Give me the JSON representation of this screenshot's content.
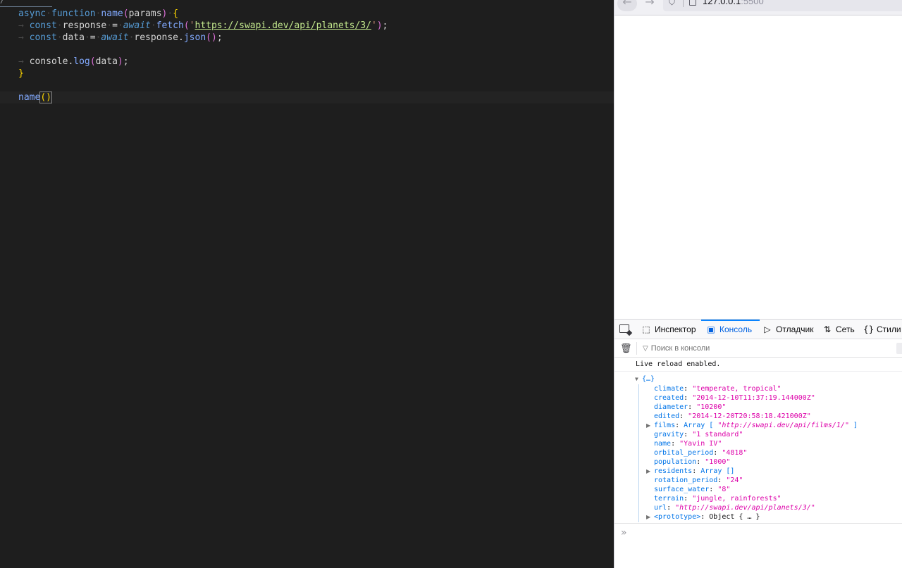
{
  "editor": {
    "lines": [
      {
        "tokens": [
          {
            "t": "async",
            "c": "kw"
          },
          {
            "t": "·",
            "c": "ws"
          },
          {
            "t": "function",
            "c": "kw"
          },
          {
            "t": "·",
            "c": "ws"
          },
          {
            "t": "name",
            "c": "fn2"
          },
          {
            "t": "(",
            "c": "br2"
          },
          {
            "t": "params",
            "c": "var"
          },
          {
            "t": ")",
            "c": "br2"
          },
          {
            "t": "·",
            "c": "ws"
          },
          {
            "t": "{",
            "c": "br1"
          }
        ]
      },
      {
        "tokens": [
          {
            "t": "→ ",
            "c": "ws"
          },
          {
            "t": "const",
            "c": "kw"
          },
          {
            "t": "·",
            "c": "ws"
          },
          {
            "t": "response",
            "c": "var"
          },
          {
            "t": "·",
            "c": "ws"
          },
          {
            "t": "=",
            "c": "op"
          },
          {
            "t": "·",
            "c": "ws"
          },
          {
            "t": "await",
            "c": "aw"
          },
          {
            "t": "·",
            "c": "ws"
          },
          {
            "t": "fetch",
            "c": "fn2"
          },
          {
            "t": "(",
            "c": "br2"
          },
          {
            "t": "'",
            "c": "str"
          },
          {
            "t": "https://swapi.dev/api/planets/3/",
            "c": "str-url"
          },
          {
            "t": "'",
            "c": "str"
          },
          {
            "t": ")",
            "c": "br2"
          },
          {
            "t": ";",
            "c": "op"
          }
        ]
      },
      {
        "tokens": [
          {
            "t": "→ ",
            "c": "ws"
          },
          {
            "t": "const",
            "c": "kw"
          },
          {
            "t": "·",
            "c": "ws"
          },
          {
            "t": "data",
            "c": "var"
          },
          {
            "t": "·",
            "c": "ws"
          },
          {
            "t": "=",
            "c": "op"
          },
          {
            "t": "·",
            "c": "ws"
          },
          {
            "t": "await",
            "c": "aw"
          },
          {
            "t": "·",
            "c": "ws"
          },
          {
            "t": "response",
            "c": "var"
          },
          {
            "t": ".",
            "c": "op"
          },
          {
            "t": "json",
            "c": "fn2"
          },
          {
            "t": "()",
            "c": "br2"
          },
          {
            "t": ";",
            "c": "op"
          }
        ]
      },
      {
        "tokens": []
      },
      {
        "tokens": [
          {
            "t": "→ ",
            "c": "ws"
          },
          {
            "t": "console",
            "c": "var"
          },
          {
            "t": ".",
            "c": "op"
          },
          {
            "t": "log",
            "c": "fn2"
          },
          {
            "t": "(",
            "c": "br2"
          },
          {
            "t": "data",
            "c": "var"
          },
          {
            "t": ")",
            "c": "br2"
          },
          {
            "t": ";",
            "c": "op"
          }
        ]
      },
      {
        "tokens": [
          {
            "t": "}",
            "c": "br1"
          }
        ]
      },
      {
        "tokens": []
      },
      {
        "tokens": [
          {
            "t": "name",
            "c": "fn2"
          },
          {
            "t": "()",
            "c": "br1 bracket-hl"
          }
        ]
      }
    ]
  },
  "browser": {
    "nav_back": "←",
    "nav_forward": "→",
    "url_host": "127.0.0.1",
    "url_port": ":5500"
  },
  "devtools": {
    "tabs": {
      "inspector": "Инспектор",
      "console": "Консоль",
      "debugger": "Отладчик",
      "network": "Сеть",
      "styles": "Стили"
    },
    "filter_placeholder": "Поиск в консоли",
    "live_reload": "Live reload enabled.",
    "object_root": "{…}",
    "props": [
      {
        "key": "climate",
        "value": "\"temperate, tropical\"",
        "kind": "str",
        "expandable": false
      },
      {
        "key": "created",
        "value": "\"2014-12-10T11:37:19.144000Z\"",
        "kind": "str",
        "expandable": false
      },
      {
        "key": "diameter",
        "value": "\"10200\"",
        "kind": "str",
        "expandable": false
      },
      {
        "key": "edited",
        "value": "\"2014-12-20T20:58:18.421000Z\"",
        "kind": "str",
        "expandable": false
      },
      {
        "key": "films",
        "value": "Array [ ",
        "kind": "obj",
        "extra": "\"http://swapi.dev/api/films/1/\"",
        "tail": " ]",
        "expandable": true
      },
      {
        "key": "gravity",
        "value": "\"1 standard\"",
        "kind": "str",
        "expandable": false
      },
      {
        "key": "name",
        "value": "\"Yavin IV\"",
        "kind": "str",
        "expandable": false
      },
      {
        "key": "orbital_period",
        "value": "\"4818\"",
        "kind": "str",
        "expandable": false
      },
      {
        "key": "population",
        "value": "\"1000\"",
        "kind": "str",
        "expandable": false
      },
      {
        "key": "residents",
        "value": "Array []",
        "kind": "obj",
        "expandable": true
      },
      {
        "key": "rotation_period",
        "value": "\"24\"",
        "kind": "str",
        "expandable": false
      },
      {
        "key": "surface_water",
        "value": "\"8\"",
        "kind": "str",
        "expandable": false
      },
      {
        "key": "terrain",
        "value": "\"jungle, rainforests\"",
        "kind": "str",
        "expandable": false
      },
      {
        "key": "url",
        "value": "\"http://swapi.dev/api/planets/3/\"",
        "kind": "url",
        "expandable": false
      },
      {
        "key": "<prototype>",
        "value": "Object { … }",
        "kind": "gray",
        "expandable": true
      }
    ],
    "prompt": "»"
  },
  "icons": {
    "picker": "element-picker-icon",
    "inspector": "inspector-icon",
    "console": "console-icon",
    "debugger": "debugger-icon",
    "network": "network-icon",
    "styles": "styles-icon",
    "trash": "trash-icon",
    "filter": "filter-icon"
  },
  "colors": {
    "accent": "#0a84ff",
    "console_key": "#0074e8",
    "console_string": "#dd00a9"
  }
}
